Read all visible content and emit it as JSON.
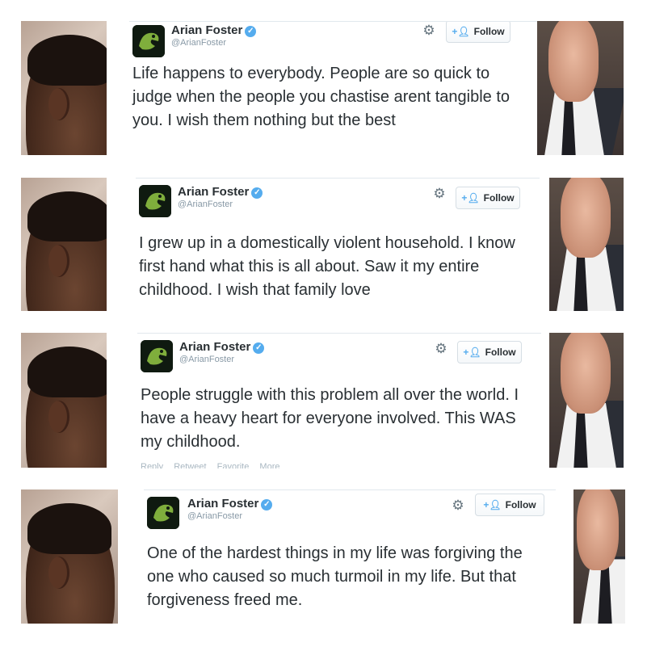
{
  "tweets": [
    {
      "name": "Arian Foster",
      "handle": "@ArianFoster",
      "follow_label": "Follow",
      "text": "Life happens to everybody. People are so quick to judge when the people you chastise arent tangible to you. I wish them nothing but the best"
    },
    {
      "name": "Arian Foster",
      "handle": "@ArianFoster",
      "follow_label": "Follow",
      "text": "I grew up in a domestically violent household. I know first hand what this is all about. Saw it my entire childhood. I wish that family love"
    },
    {
      "name": "Arian Foster",
      "handle": "@ArianFoster",
      "follow_label": "Follow",
      "text": "People struggle with this problem all over the world. I have a heavy heart for everyone involved. This WAS my childhood.",
      "actions": [
        "Reply",
        "Retweet",
        "Favorite",
        "More"
      ]
    },
    {
      "name": "Arian Foster",
      "handle": "@ArianFoster",
      "follow_label": "Follow",
      "text": "One of the hardest things in my life was forgiving the one who caused so much turmoil in my life. But that forgiveness freed me."
    }
  ],
  "icons": {
    "verified": "verified-badge-icon",
    "gear": "gear-icon",
    "follow": "add-user-icon"
  },
  "colors": {
    "verified": "#55acee",
    "text": "#292f33",
    "muted": "#8899a6"
  }
}
